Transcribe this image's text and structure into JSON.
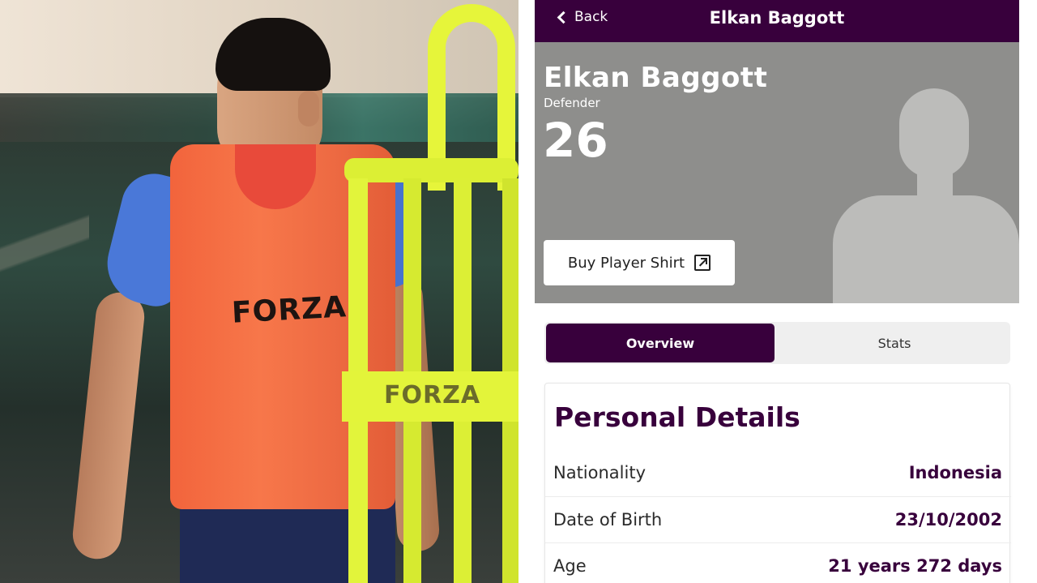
{
  "photo": {
    "bib_text": "FORZA",
    "mannequin_text": "FORZA"
  },
  "topbar": {
    "back_label": "Back",
    "title": "Elkan Baggott"
  },
  "hero": {
    "name": "Elkan Baggott",
    "position": "Defender",
    "number": "26",
    "buy_shirt_label": "Buy Player Shirt",
    "icons": {
      "external_link": "external-link-icon",
      "silhouette": "player-silhouette"
    }
  },
  "tabs": [
    {
      "label": "Overview",
      "active": true
    },
    {
      "label": "Stats",
      "active": false
    }
  ],
  "personal_details": {
    "title": "Personal Details",
    "rows": [
      {
        "label": "Nationality",
        "value": "Indonesia"
      },
      {
        "label": "Date of Birth",
        "value": "23/10/2002"
      },
      {
        "label": "Age",
        "value": "21 years 272 days"
      }
    ]
  },
  "colors": {
    "brand_purple": "#38003c",
    "hero_grey": "#8e8e8c"
  }
}
